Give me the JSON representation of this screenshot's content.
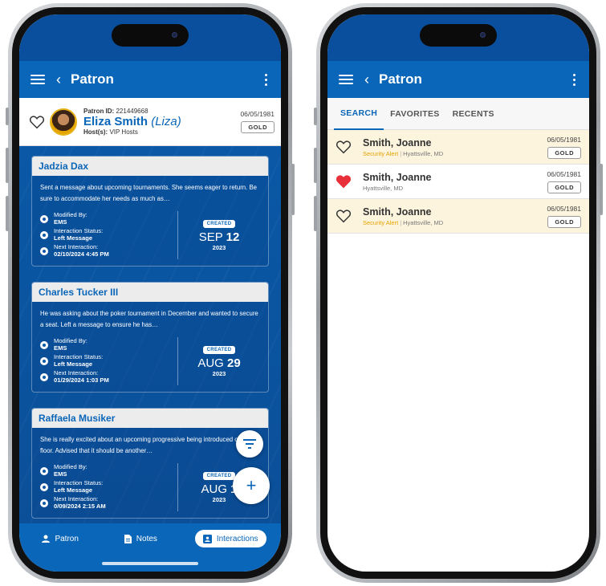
{
  "left_phone": {
    "appbar": {
      "title": "Patron"
    },
    "patron": {
      "id_label": "Patron ID:",
      "id_value": "221449668",
      "name": "Eliza Smith",
      "nickname": "(Liza)",
      "hosts_label": "Host(s):",
      "hosts_value": "VIP Hosts",
      "date": "06/05/1981",
      "tier": "GOLD"
    },
    "labels": {
      "modified_by": "Modified By:",
      "interaction_status": "Interaction Status:",
      "next_interaction": "Next Interaction:",
      "created": "CREATED"
    },
    "cards": [
      {
        "name": "Jadzia Dax",
        "text": "Sent a message about upcoming tournaments. She seems eager to return. Be sure to accommodate her needs as much as…",
        "modified_by": "EMS",
        "status": "Left Message",
        "next": "02/10/2024 4:45 PM",
        "month": "SEP",
        "day": "12",
        "year": "2023"
      },
      {
        "name": "Charles Tucker III",
        "text": "He was asking about the poker tournament in December and wanted to secure a seat. Left a message to ensure he has…",
        "modified_by": "EMS",
        "status": "Left Message",
        "next": "01/29/2024 1:03 PM",
        "month": "AUG",
        "day": "29",
        "year": "2023"
      },
      {
        "name": "Raffaela Musiker",
        "text": "She is really excited about an upcoming progressive being introduced on the floor. Advised that it should be another…",
        "modified_by": "EMS",
        "status": "Left Message",
        "next": "0/09/2024 2:15 AM",
        "month": "AUG",
        "day": "1",
        "year": "2023"
      }
    ],
    "fab": {
      "add": "+"
    },
    "nav": {
      "patron": "Patron",
      "notes": "Notes",
      "interactions": "Interactions"
    }
  },
  "right_phone": {
    "appbar": {
      "title": "Patron"
    },
    "tabs": [
      "SEARCH",
      "FAVORITES",
      "RECENTS"
    ],
    "results": [
      {
        "name": "Smith, Joanne",
        "alert": "Security Alert",
        "location": "Hyattsville, MD",
        "date": "06/05/1981",
        "tier": "GOLD",
        "favorite": false
      },
      {
        "name": "Smith, Joanne",
        "alert": "",
        "location": "Hyattsville, MD",
        "date": "06/05/1981",
        "tier": "GOLD",
        "favorite": true
      },
      {
        "name": "Smith, Joanne",
        "alert": "Security Alert",
        "location": "Hyattsville, MD",
        "date": "06/05/1981",
        "tier": "GOLD",
        "favorite": false
      }
    ]
  },
  "colors": {
    "primary": "#0a66b8",
    "alert": "#e4a300",
    "favorite": "#e8303a"
  }
}
